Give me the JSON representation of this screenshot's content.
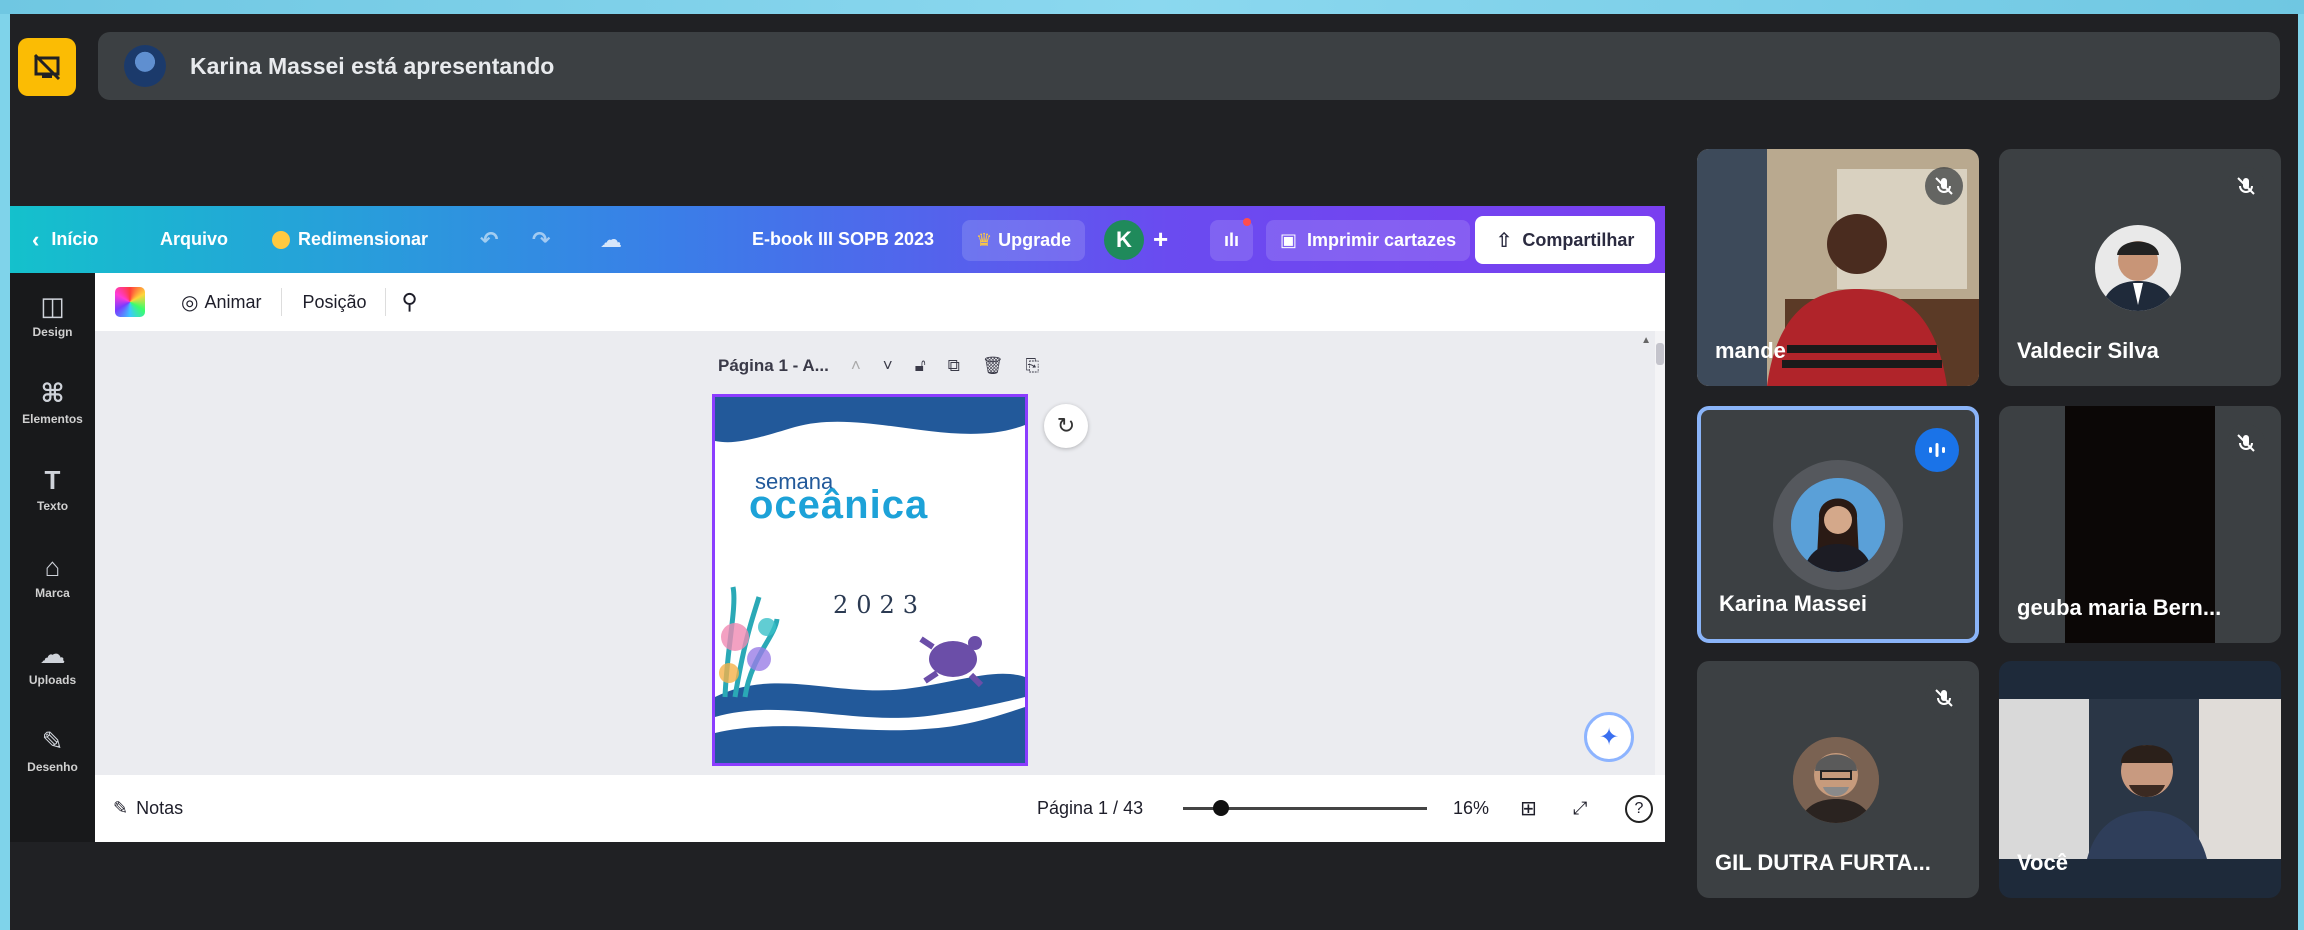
{
  "meet": {
    "presenting_text": "Karina Massei está apresentando",
    "participants": [
      {
        "name": "mande",
        "muted": true
      },
      {
        "name": "Valdecir Silva",
        "muted": true
      },
      {
        "name": "Karina Massei",
        "muted": false,
        "speaking": true
      },
      {
        "name": "geuba maria Bern...",
        "muted": true
      },
      {
        "name": "GIL DUTRA FURTA...",
        "muted": true
      },
      {
        "name": "Você",
        "muted": false
      }
    ]
  },
  "canva": {
    "top": {
      "home": "Início",
      "file": "Arquivo",
      "resize": "Redimensionar",
      "doc_title": "E-book III SOPB 2023",
      "upgrade": "Upgrade",
      "avatar_letter": "K",
      "print": "Imprimir cartazes",
      "share": "Compartilhar"
    },
    "sidebar": [
      "Design",
      "Elementos",
      "Texto",
      "Marca",
      "Uploads",
      "Desenho"
    ],
    "toolbar": {
      "animate": "Animar",
      "position": "Posição"
    },
    "page_label": "Página 1 - A...",
    "bottom": {
      "notes": "Notas",
      "page_count": "Página 1 / 43",
      "zoom": "16%",
      "zoom_level": 0.16
    },
    "design": {
      "brand_small": "semana",
      "brand_big": "oceânica",
      "year": "2023"
    }
  },
  "colors": {
    "meet_bg": "#202124",
    "tile_bg": "#3c4043",
    "accent_blue": "#1a73e8",
    "canva_purple": "#8b3dff",
    "present_yellow": "#fbbc04"
  }
}
